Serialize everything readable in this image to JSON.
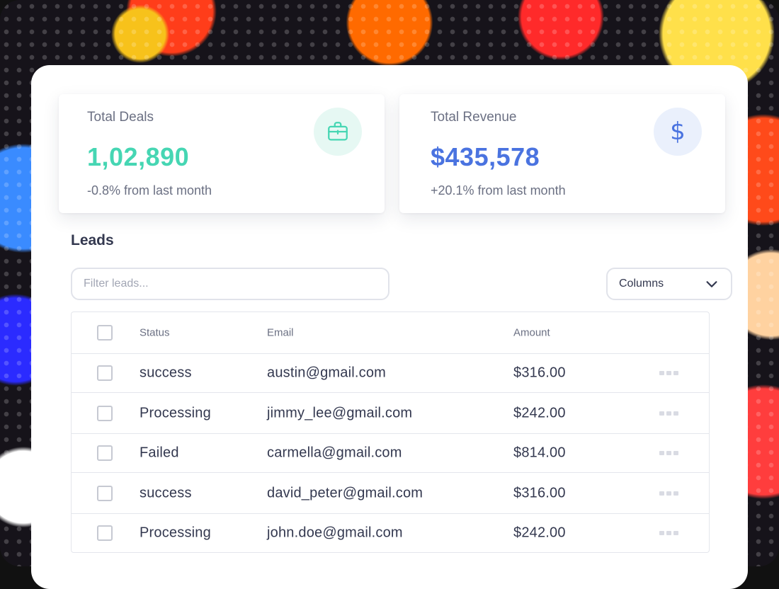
{
  "stats": {
    "deals": {
      "title": "Total Deals",
      "value": "1,02,890",
      "change": "-0.8% from last month",
      "icon": "briefcase-icon",
      "accent": "#46d6b3"
    },
    "revenue": {
      "title": "Total Revenue",
      "value": "$435,578",
      "change": "+20.1% from last month",
      "icon": "dollar-icon",
      "accent": "#4a73e0"
    }
  },
  "leads": {
    "title": "Leads",
    "filter_placeholder": "Filter leads...",
    "columns_label": "Columns",
    "headers": {
      "status": "Status",
      "email": "Email",
      "amount": "Amount"
    },
    "rows": [
      {
        "status": "success",
        "email": "austin@gmail.com",
        "amount": "$316.00"
      },
      {
        "status": "Processing",
        "email": "jimmy_lee@gmail.com",
        "amount": "$242.00"
      },
      {
        "status": "Failed",
        "email": "carmella@gmail.com",
        "amount": "$814.00"
      },
      {
        "status": "success",
        "email": "david_peter@gmail.com",
        "amount": "$316.00"
      },
      {
        "status": "Processing",
        "email": "john.doe@gmail.com",
        "amount": "$242.00"
      }
    ]
  }
}
